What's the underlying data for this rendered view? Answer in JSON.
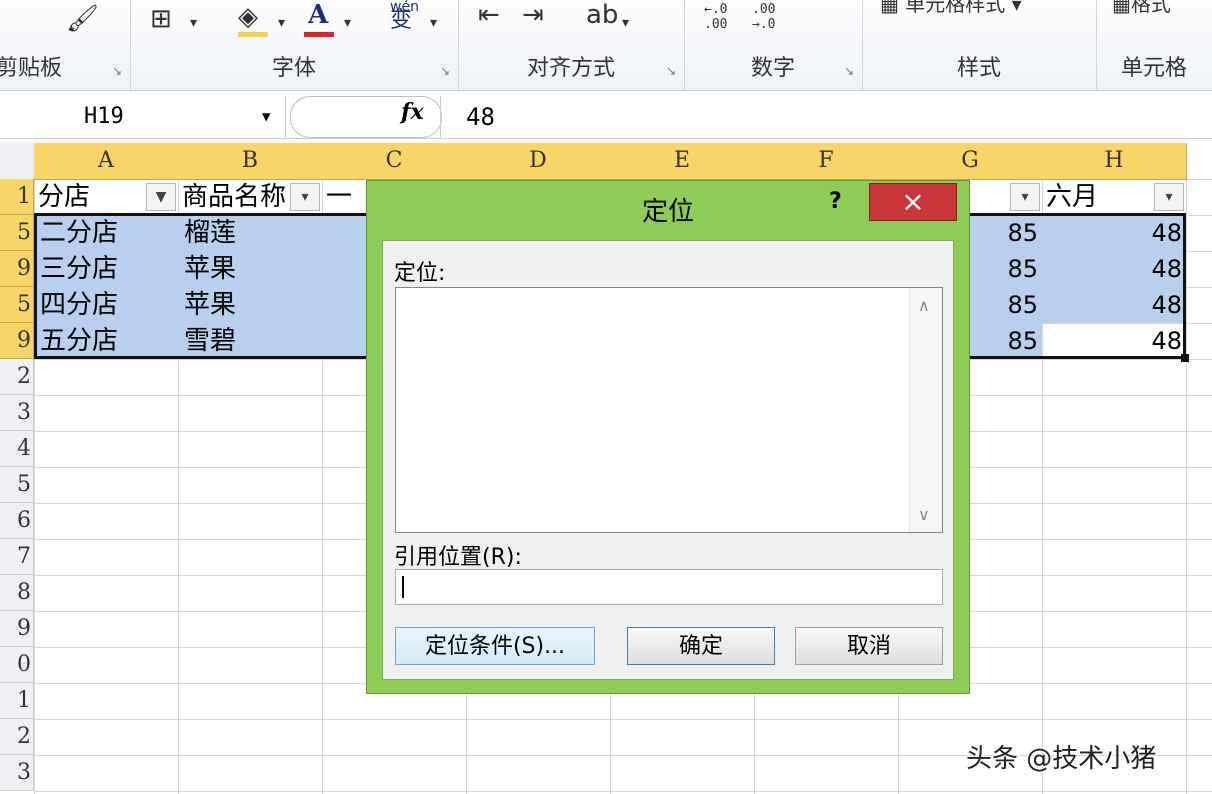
{
  "ribbon": {
    "groups": [
      {
        "label": "剪贴板"
      },
      {
        "label": "字体"
      },
      {
        "label": "对齐方式"
      },
      {
        "label": "数字"
      },
      {
        "label": "样式"
      },
      {
        "label": "单元格"
      }
    ],
    "styles_label": "单元格样式",
    "format_label": "格式",
    "phonetic_glyph": "wén",
    "phonetic_char": "变",
    "font_color_letter": "A",
    "decimal_inc": "←.0\n.00",
    "decimal_dec": ".00\n→.0"
  },
  "formula_bar": {
    "name_box": "H19",
    "fx": "fx",
    "value": "48"
  },
  "columns": [
    "A",
    "B",
    "C",
    "D",
    "E",
    "F",
    "G",
    "H"
  ],
  "rows": [
    "1",
    "5",
    "9",
    "5",
    "9",
    "2",
    "3",
    "4",
    "5",
    "6",
    "7",
    "8",
    "9",
    "0",
    "1",
    "2",
    "3"
  ],
  "cells": {
    "A1": "分店",
    "B1": "商品名称",
    "C1": "一",
    "H1": "六月",
    "data": [
      {
        "a": "二分店",
        "b": "榴莲",
        "g": "85",
        "h": "48"
      },
      {
        "a": "三分店",
        "b": "苹果",
        "g": "85",
        "h": "48"
      },
      {
        "a": "四分店",
        "b": "苹果",
        "g": "85",
        "h": "48"
      },
      {
        "a": "五分店",
        "b": "雪碧",
        "g": "85",
        "h": "48"
      }
    ]
  },
  "dialog": {
    "title": "定位",
    "help": "?",
    "close": "×",
    "goto_label": "定位:",
    "ref_label": "引用位置(R):",
    "ref_value": "",
    "special_button": "定位条件(S)...",
    "ok_button": "确定",
    "cancel_button": "取消"
  },
  "watermark": "头条 @技术小猪"
}
